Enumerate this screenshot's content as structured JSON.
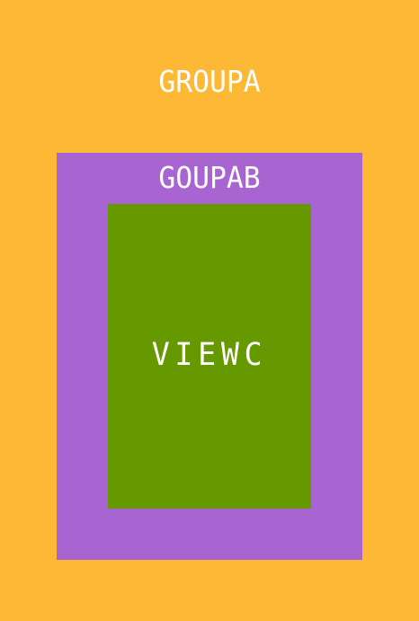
{
  "groupA": {
    "label": "GROUPA",
    "color": "#FDB935"
  },
  "groupB": {
    "label": "GOUPAB",
    "color": "#A865D1"
  },
  "viewC": {
    "label": "VIEWC",
    "color": "#669900"
  },
  "text_color": "#FFFFFF"
}
